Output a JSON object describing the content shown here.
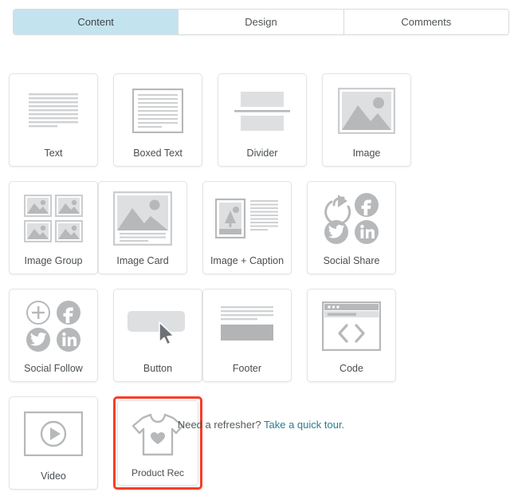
{
  "tabs": [
    {
      "label": "Content",
      "active": true
    },
    {
      "label": "Design",
      "active": false
    },
    {
      "label": "Comments",
      "active": false
    }
  ],
  "colors": {
    "active_tab_bg": "#c3e4ee",
    "highlight_border": "#fa3c28",
    "icon_gray": "#b6b8ba",
    "icon_light_gray": "#dcdddf",
    "link": "#2a7c93",
    "card_border": "#e2e4e5"
  },
  "blocks": [
    {
      "label": "Text",
      "icon": "text-lines-icon",
      "selected": false
    },
    {
      "label": "Boxed Text",
      "icon": "boxed-text-icon",
      "selected": false
    },
    {
      "label": "Divider",
      "icon": "divider-icon",
      "selected": false
    },
    {
      "label": "Image",
      "icon": "image-icon",
      "selected": false
    },
    {
      "label": "Image Group",
      "icon": "image-group-icon",
      "selected": false
    },
    {
      "label": "Image Card",
      "icon": "image-card-icon",
      "selected": false
    },
    {
      "label": "Image + Caption",
      "icon": "image-caption-icon",
      "selected": false
    },
    {
      "label": "Social Share",
      "icon": "social-share-icon",
      "selected": false
    },
    {
      "label": "Social Follow",
      "icon": "social-follow-icon",
      "selected": false
    },
    {
      "label": "Button",
      "icon": "button-cursor-icon",
      "selected": false
    },
    {
      "label": "Footer",
      "icon": "footer-icon",
      "selected": false
    },
    {
      "label": "Code",
      "icon": "code-browser-icon",
      "selected": false
    },
    {
      "label": "Video",
      "icon": "video-play-icon",
      "selected": false
    },
    {
      "label": "Product Rec",
      "icon": "tshirt-heart-icon",
      "selected": true
    }
  ],
  "footer": {
    "prompt": "Need a refresher?",
    "link_text": "Take a quick tour.",
    "after": ""
  }
}
